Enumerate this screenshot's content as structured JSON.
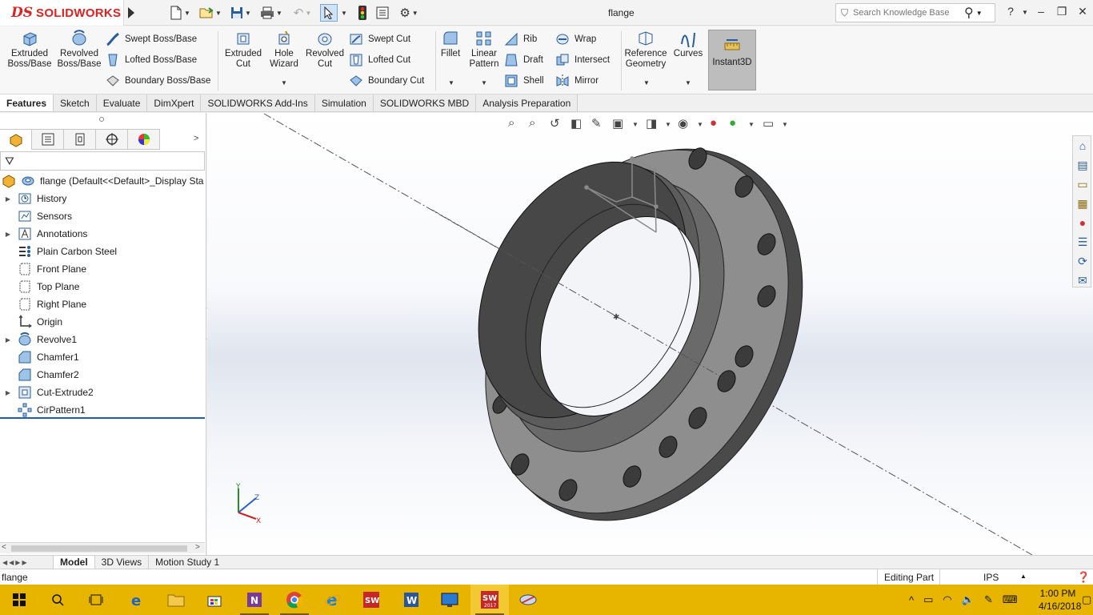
{
  "app": {
    "logo_prefix": "DS",
    "logo_name": "SOLIDWORKS",
    "document_title": "flange"
  },
  "search": {
    "placeholder": "Search Knowledge Base"
  },
  "toolbar": {
    "extruded_boss": "Extruded Boss/Base",
    "revolved_boss": "Revolved Boss/Base",
    "swept_boss": "Swept Boss/Base",
    "lofted_boss": "Lofted Boss/Base",
    "boundary_boss": "Boundary Boss/Base",
    "extruded_cut": "Extruded Cut",
    "hole_wizard": "Hole Wizard",
    "revolved_cut": "Revolved Cut",
    "swept_cut": "Swept Cut",
    "lofted_cut": "Lofted Cut",
    "boundary_cut": "Boundary Cut",
    "fillet": "Fillet",
    "linear_pattern": "Linear Pattern",
    "rib": "Rib",
    "draft": "Draft",
    "shell": "Shell",
    "wrap": "Wrap",
    "intersect": "Intersect",
    "mirror": "Mirror",
    "reference_geometry": "Reference Geometry",
    "curves": "Curves",
    "instant3d": "Instant3D"
  },
  "tabs": [
    {
      "label": "Features"
    },
    {
      "label": "Sketch"
    },
    {
      "label": "Evaluate"
    },
    {
      "label": "DimXpert"
    },
    {
      "label": "SOLIDWORKS Add-Ins"
    },
    {
      "label": "Simulation"
    },
    {
      "label": "SOLIDWORKS MBD"
    },
    {
      "label": "Analysis Preparation"
    }
  ],
  "tree": {
    "root": "flange  (Default<<Default>_Display Sta",
    "items": [
      {
        "label": "History"
      },
      {
        "label": "Sensors"
      },
      {
        "label": "Annotations"
      },
      {
        "label": "Plain Carbon Steel"
      },
      {
        "label": "Front Plane"
      },
      {
        "label": "Top Plane"
      },
      {
        "label": "Right Plane"
      },
      {
        "label": "Origin"
      },
      {
        "label": "Revolve1"
      },
      {
        "label": "Chamfer1"
      },
      {
        "label": "Chamfer2"
      },
      {
        "label": "Cut-Extrude2"
      },
      {
        "label": "CirPattern1"
      }
    ]
  },
  "triad": {
    "x": "X",
    "y": "Y",
    "z": "Z"
  },
  "bottom_tabs": [
    {
      "label": "Model"
    },
    {
      "label": "3D Views"
    },
    {
      "label": "Motion Study 1"
    }
  ],
  "status": {
    "name": "flange",
    "mode": "Editing Part",
    "units": "IPS"
  },
  "clock": {
    "time": "1:00 PM",
    "date": "4/16/2018"
  },
  "colors": {
    "accent": "#d22222",
    "taskbar": "#e7b400",
    "model_face": "#8c8c8c",
    "model_dark": "#4f4f4f"
  }
}
